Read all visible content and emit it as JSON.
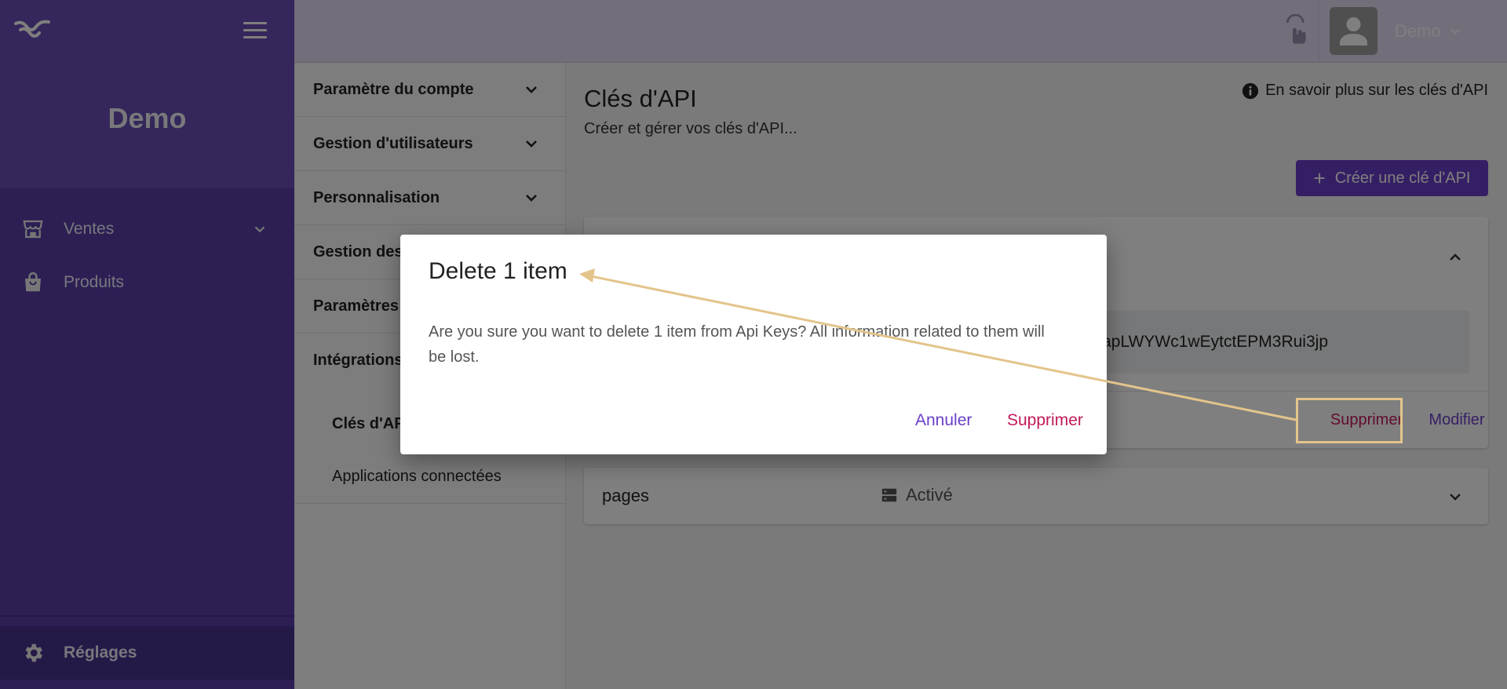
{
  "sidebar": {
    "brand": "Demo",
    "items": [
      {
        "label": "Ventes",
        "icon": "store-icon"
      },
      {
        "label": "Produits",
        "icon": "shopping-bag-icon"
      }
    ],
    "settings_label": "Réglages"
  },
  "topbar": {
    "user_name": "Demo"
  },
  "settings_nav": {
    "sections": [
      {
        "label": "Paramètre du compte"
      },
      {
        "label": "Gestion d'utilisateurs"
      },
      {
        "label": "Personnalisation"
      },
      {
        "label": "Gestion des"
      },
      {
        "label": "Paramètres"
      },
      {
        "label": "Intégrations"
      }
    ],
    "sub_items": [
      {
        "label": "Clés d'API",
        "active": true
      },
      {
        "label": "Applications connectées",
        "active": false
      }
    ]
  },
  "main": {
    "title": "Clés d'API",
    "subtitle": "Créer et gérer vos clés d'API...",
    "learn_more": "En savoir plus sur les clés d'API",
    "create_button": "Créer une clé d'API",
    "key_card": {
      "api_key": "apLWYWc1wEytctEPM3Rui3jp",
      "delete_label": "Supprimer",
      "edit_label": "Modifier"
    },
    "pages_card": {
      "name": "pages",
      "status": "Activé"
    }
  },
  "dialog": {
    "title": "Delete 1 item",
    "message": "Are you sure you want to delete 1 item from Api Keys? All information related to them will be lost.",
    "cancel_label": "Annuler",
    "confirm_label": "Supprimer"
  },
  "colors": {
    "sidebar": "#5b3fa8",
    "accent": "#6a3fc8",
    "danger": "#c2185b",
    "annotation": "#e3c48b"
  }
}
